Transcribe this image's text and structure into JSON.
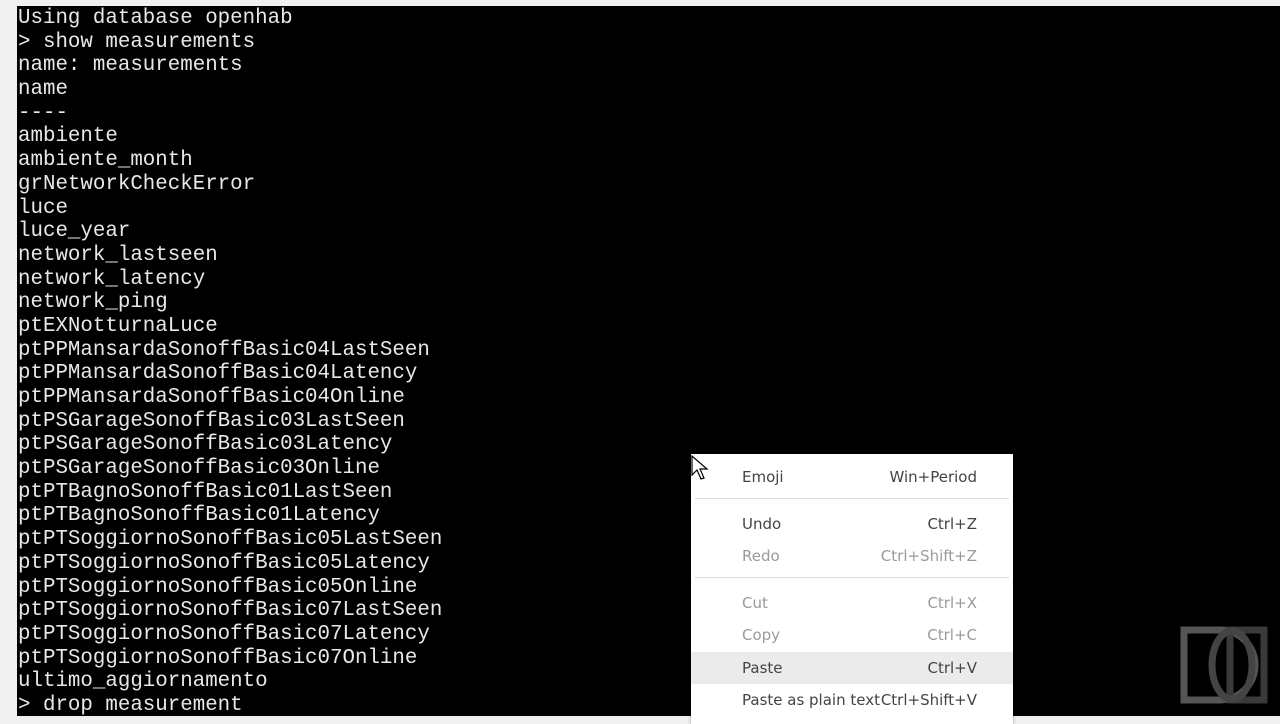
{
  "terminal": {
    "lines": [
      "Using database openhab",
      "> show measurements",
      "name: measurements",
      "name",
      "----",
      "ambiente",
      "ambiente_month",
      "grNetworkCheckError",
      "luce",
      "luce_year",
      "network_lastseen",
      "network_latency",
      "network_ping",
      "ptEXNotturnaLuce",
      "ptPPMansardaSonoffBasic04LastSeen",
      "ptPPMansardaSonoffBasic04Latency",
      "ptPPMansardaSonoffBasic04Online",
      "ptPSGarageSonoffBasic03LastSeen",
      "ptPSGarageSonoffBasic03Latency",
      "ptPSGarageSonoffBasic03Online",
      "ptPTBagnoSonoffBasic01LastSeen",
      "ptPTBagnoSonoffBasic01Latency",
      "ptPTSoggiornoSonoffBasic05LastSeen",
      "ptPTSoggiornoSonoffBasic05Latency",
      "ptPTSoggiornoSonoffBasic05Online",
      "ptPTSoggiornoSonoffBasic07LastSeen",
      "ptPTSoggiornoSonoffBasic07Latency",
      "ptPTSoggiornoSonoffBasic07Online",
      "ultimo_aggiornamento",
      "> drop measurement"
    ]
  },
  "context_menu": {
    "items": [
      {
        "label": "Emoji",
        "shortcut": "Win+Period",
        "enabled": true
      },
      {
        "label": "Undo",
        "shortcut": "Ctrl+Z",
        "enabled": true
      },
      {
        "label": "Redo",
        "shortcut": "Ctrl+Shift+Z",
        "enabled": false
      },
      {
        "label": "Cut",
        "shortcut": "Ctrl+X",
        "enabled": false
      },
      {
        "label": "Copy",
        "shortcut": "Ctrl+C",
        "enabled": false
      },
      {
        "label": "Paste",
        "shortcut": "Ctrl+V",
        "enabled": true,
        "hovered": true
      },
      {
        "label": "Paste as plain text",
        "shortcut": "Ctrl+Shift+V",
        "enabled": true
      }
    ]
  },
  "colors": {
    "terminal_bg": "#000000",
    "terminal_fg": "#e8e8e8",
    "menu_bg": "#ffffff",
    "hover_bg": "#ebebeb"
  }
}
